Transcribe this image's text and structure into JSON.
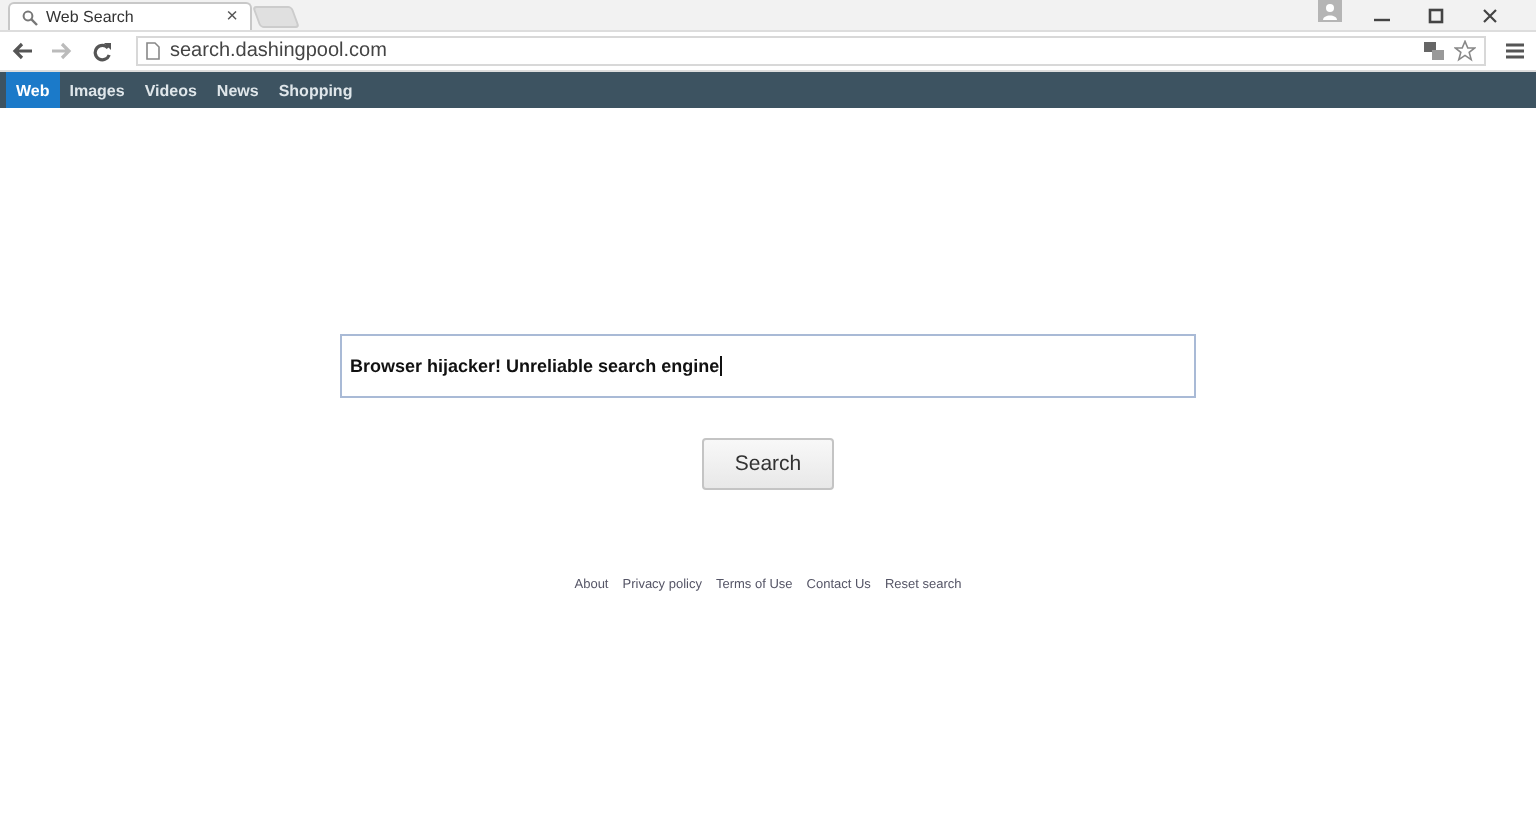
{
  "browser": {
    "tab": {
      "title": "Web Search",
      "close": "×"
    },
    "address": "search.dashingpool.com"
  },
  "nav": [
    {
      "label": "Web",
      "selected": true
    },
    {
      "label": "Images",
      "selected": false
    },
    {
      "label": "Videos",
      "selected": false
    },
    {
      "label": "News",
      "selected": false
    },
    {
      "label": "Shopping",
      "selected": false
    }
  ],
  "search": {
    "value": "Browser hijacker! Unreliable search engine",
    "button": "Search"
  },
  "footer_links": [
    "About",
    "Privacy policy",
    "Terms of Use",
    "Contact Us",
    "Reset search"
  ]
}
